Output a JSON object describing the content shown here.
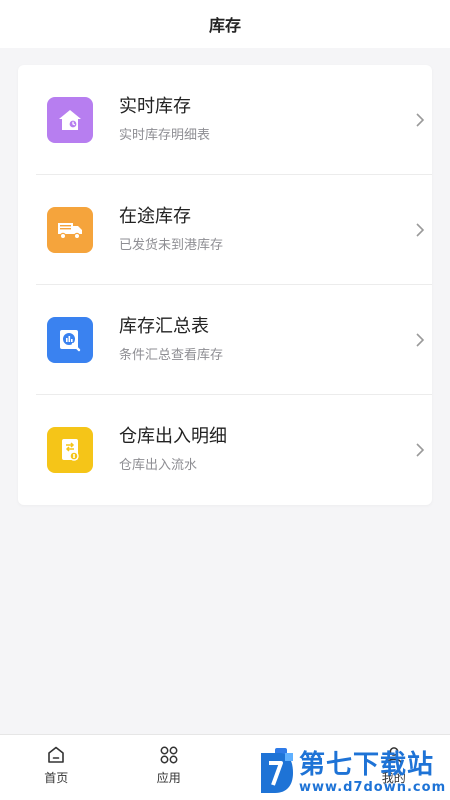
{
  "header": {
    "title": "库存"
  },
  "menu": [
    {
      "title": "实时库存",
      "subtitle": "实时库存明细表",
      "icon": "home-stock-icon",
      "color": "#b77ef0"
    },
    {
      "title": "在途库存",
      "subtitle": "已发货未到港库存",
      "icon": "truck-icon",
      "color": "#f5a43c"
    },
    {
      "title": "库存汇总表",
      "subtitle": "条件汇总查看库存",
      "icon": "report-search-icon",
      "color": "#3a82f0"
    },
    {
      "title": "仓库出入明细",
      "subtitle": "仓库出入流水",
      "icon": "warehouse-transfer-icon",
      "color": "#f5c518"
    }
  ],
  "tabbar": {
    "tabs": [
      {
        "label": "首页",
        "icon": "home-icon"
      },
      {
        "label": "应用",
        "icon": "apps-icon"
      },
      {
        "label": "",
        "icon": "stock-icon"
      },
      {
        "label": "我的",
        "icon": "user-icon"
      }
    ]
  },
  "watermark": {
    "title": "第七下载站",
    "url": "www.d7down.com",
    "color": "#1e73d6"
  }
}
